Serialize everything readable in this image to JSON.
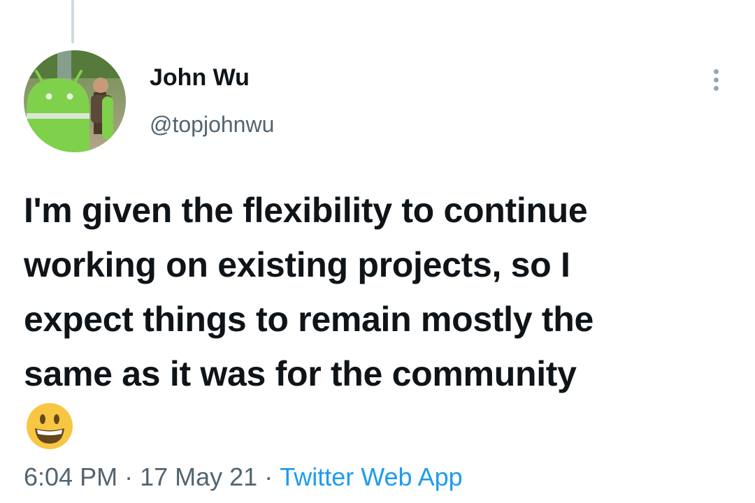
{
  "tweet": {
    "author_name": "John Wu",
    "author_handle": "@topjohnwu",
    "text_lines": [
      "I'm given the flexibility to continue",
      "working on existing projects, so I",
      "expect things to remain mostly the",
      "same as it was for the community"
    ],
    "emoji": "grinning-face",
    "time": "6:04 PM",
    "separator": "·",
    "date": "17 May 21",
    "source": "Twitter Web App"
  },
  "icons": {
    "more": "more-vertical-icon",
    "avatar": "android-mascot-avatar"
  },
  "colors": {
    "text_primary": "#0f1419",
    "text_secondary": "#536471",
    "link": "#1d9bf0",
    "thread_line": "#cfd9de",
    "emoji_face": "#f7c744"
  }
}
